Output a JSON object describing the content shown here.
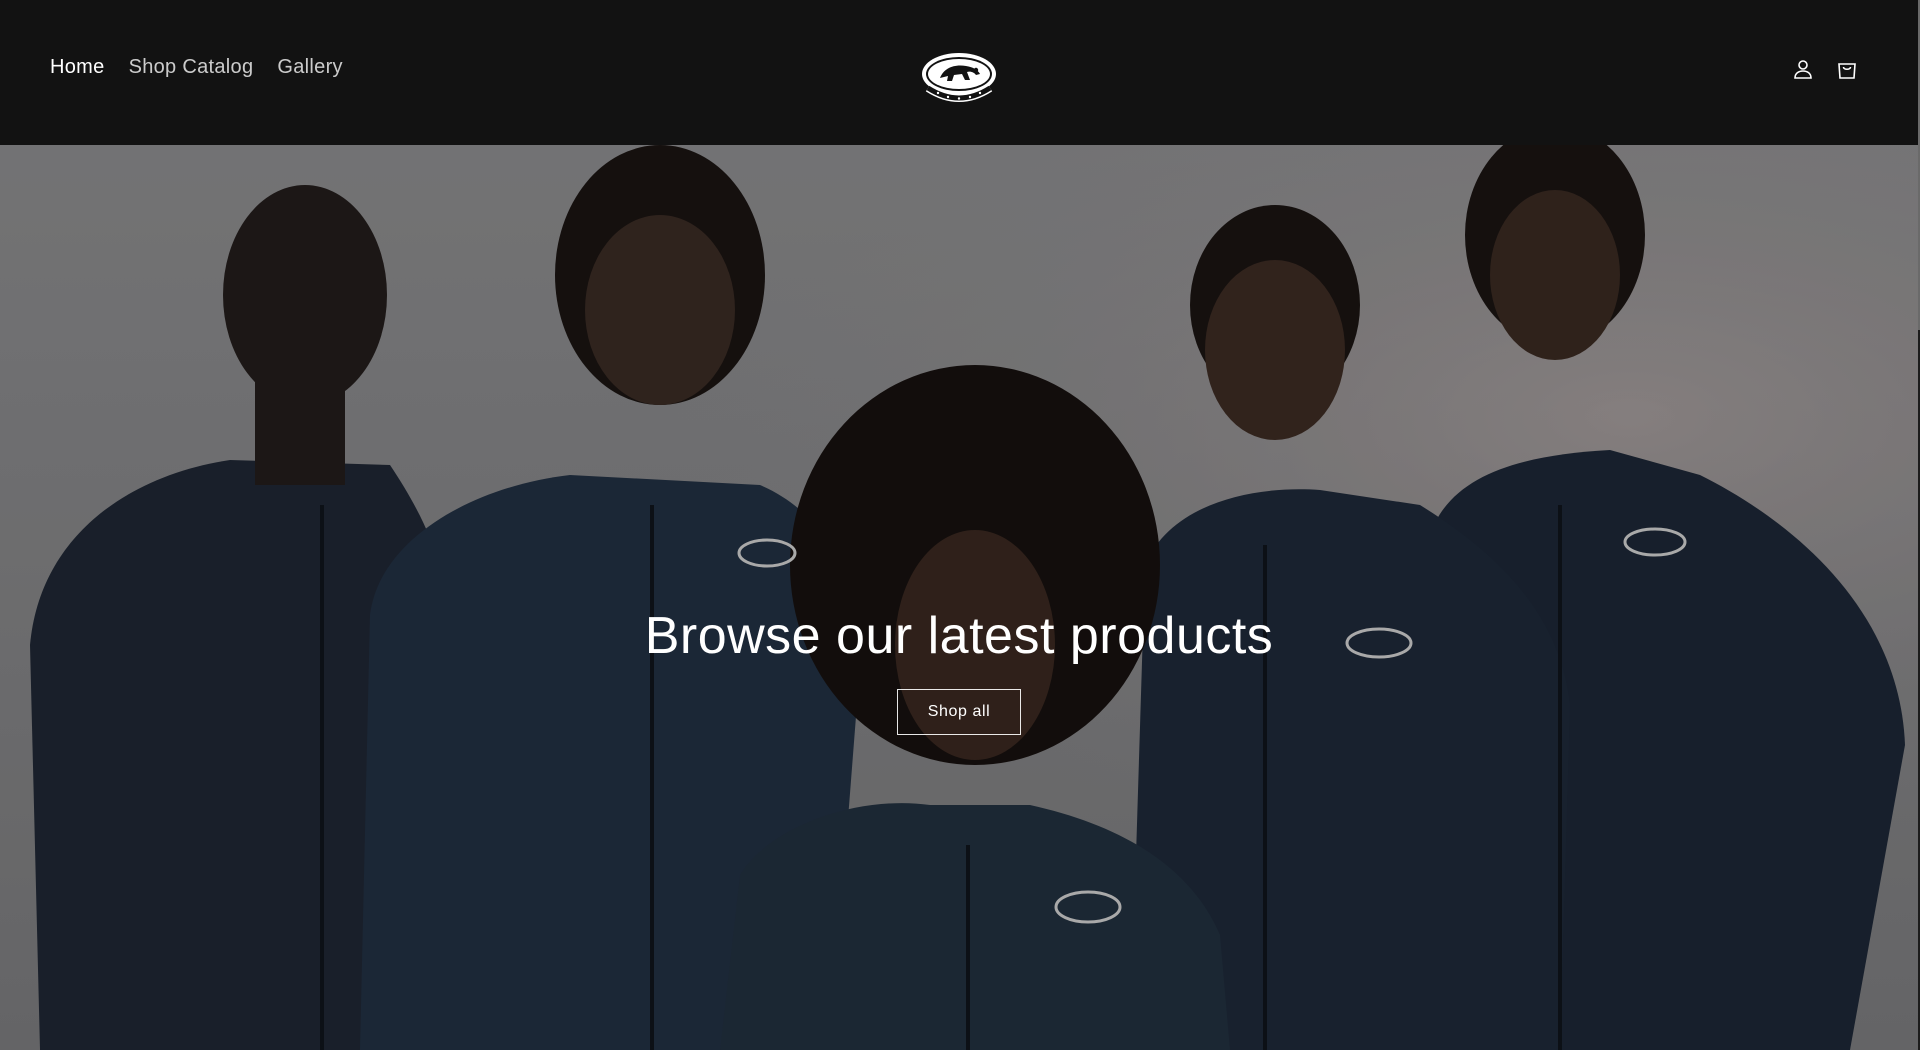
{
  "header": {
    "nav": [
      {
        "label": "Home",
        "active": true
      },
      {
        "label": "Shop Catalog",
        "active": false
      },
      {
        "label": "Gallery",
        "active": false
      }
    ],
    "logo_icon": "panther-emblem-logo",
    "account_icon": "user-icon",
    "cart_icon": "shopping-bag-icon"
  },
  "hero": {
    "heading": "Browse our latest products",
    "button_label": "Shop all"
  },
  "colors": {
    "header_bg": "#121212",
    "hero_text": "#ffffff",
    "hoodie": "#1f2a38"
  }
}
